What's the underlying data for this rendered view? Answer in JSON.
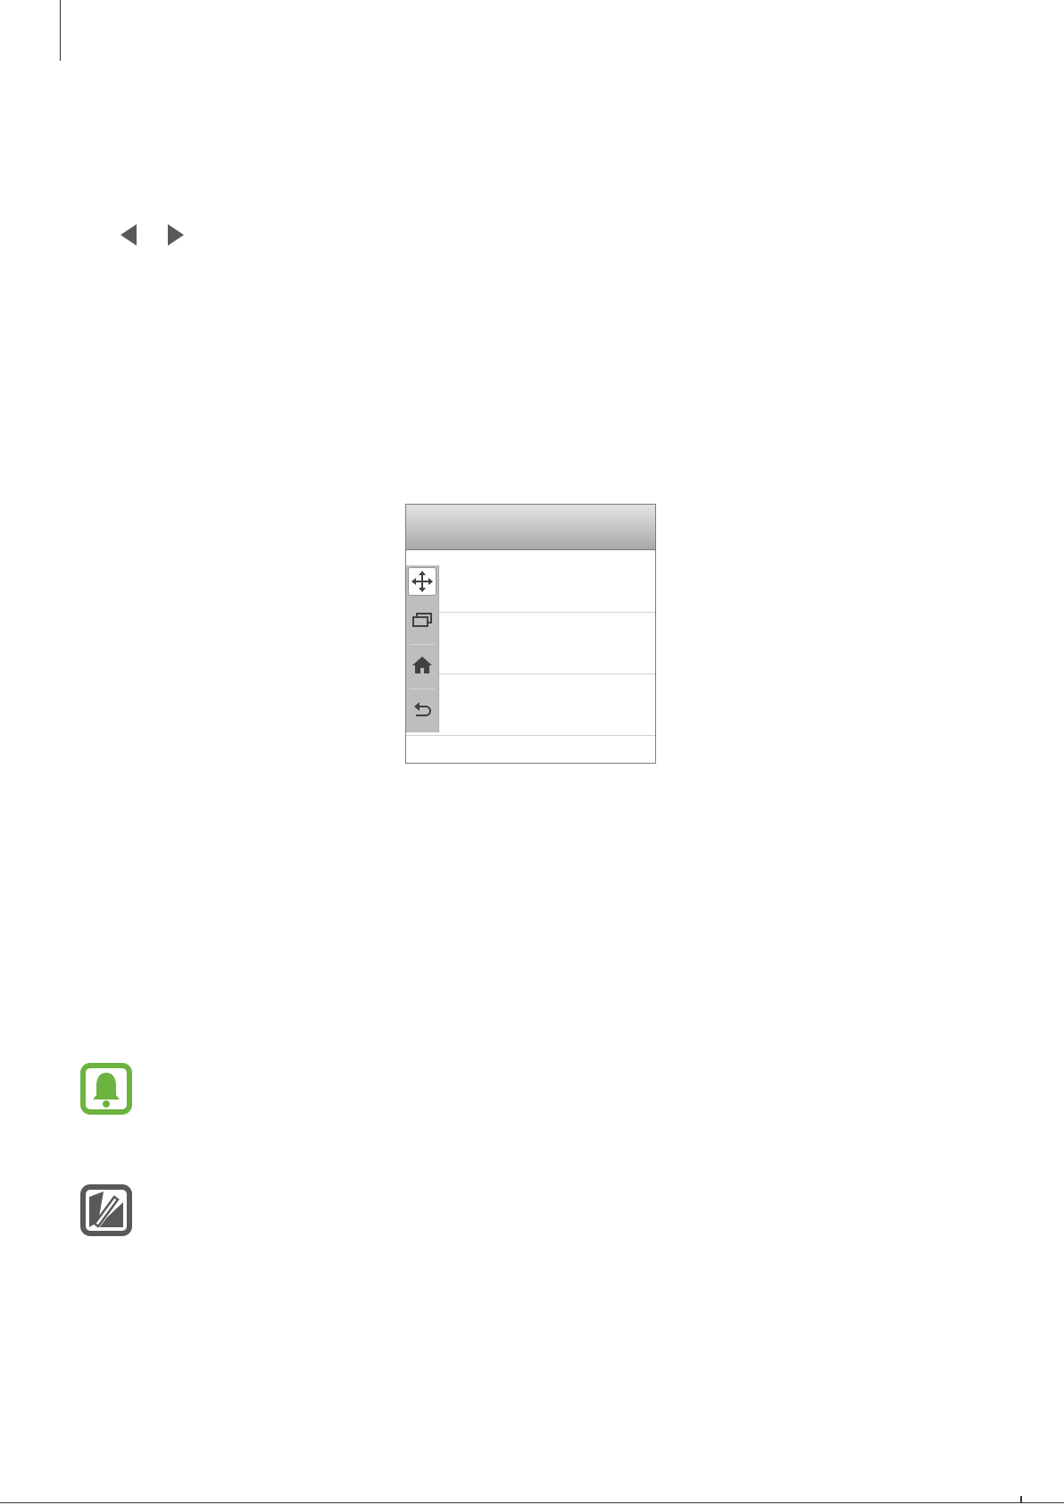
{
  "nav_arrows": {
    "previous_icon": "triangle-left-icon",
    "next_icon": "triangle-right-icon",
    "color": "#58595b"
  },
  "mockup": {
    "header_color": "#b8b8b8",
    "toolbar_color": "#bcbec0",
    "toolbar_items": [
      {
        "icon": "move-icon",
        "active": true
      },
      {
        "icon": "recent-apps-icon",
        "active": false
      },
      {
        "icon": "home-icon",
        "active": false
      },
      {
        "icon": "back-icon",
        "active": false
      }
    ]
  },
  "notices": [
    {
      "icon": "bell-icon",
      "color": "#6cb33f"
    },
    {
      "icon": "pen-note-icon",
      "color": "#58595b"
    }
  ]
}
